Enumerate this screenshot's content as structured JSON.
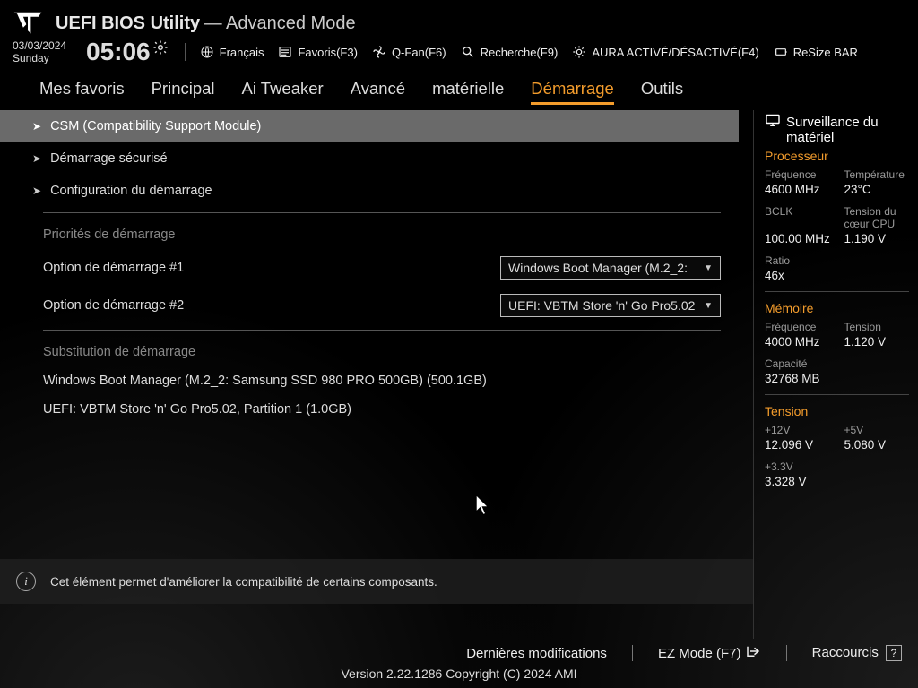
{
  "header": {
    "title": "UEFI BIOS Utility",
    "mode": "— Advanced Mode",
    "date": "03/03/2024",
    "day": "Sunday",
    "time": "05:06"
  },
  "shortcuts": {
    "language": "Français",
    "favorites": "Favoris(F3)",
    "qfan": "Q-Fan(F6)",
    "search": "Recherche(F9)",
    "aura": "AURA ACTIVÉ/DÉSACTIVÉ(F4)",
    "resize_bar": "ReSize BAR"
  },
  "tabs": {
    "favorites": "Mes favoris",
    "main": "Principal",
    "ai_tweaker": "Ai Tweaker",
    "advanced": "Avancé",
    "hardware": "matérielle",
    "boot": "Démarrage",
    "tools": "Outils"
  },
  "content": {
    "csm": "CSM (Compatibility Support Module)",
    "secure_boot": "Démarrage sécurisé",
    "boot_config": "Configuration du démarrage",
    "boot_priority": "Priorités de démarrage",
    "boot_option_1_label": "Option de démarrage #1",
    "boot_option_1_value": "Windows Boot Manager (M.2_2:",
    "boot_option_2_label": "Option de démarrage #2",
    "boot_option_2_value": "UEFI: VBTM Store 'n' Go Pro5.02",
    "boot_override": "Substitution de démarrage",
    "override_1": "Windows Boot Manager (M.2_2: Samsung SSD 980 PRO 500GB) (500.1GB)",
    "override_2": "UEFI: VBTM Store 'n' Go Pro5.02, Partition 1 (1.0GB)",
    "help_text": "Cet élément permet d'améliorer la compatibilité de certains composants."
  },
  "sidebar": {
    "title_line1": "Surveillance du",
    "title_line2": "matériel",
    "proc_heading": "Processeur",
    "freq_label": "Fréquence",
    "freq_value": "4600 MHz",
    "temp_label": "Température",
    "temp_value": "23°C",
    "bclk_label": "BCLK",
    "bclk_value": "100.00 MHz",
    "vcore_label": "Tension du cœur CPU",
    "vcore_value": "1.190 V",
    "ratio_label": "Ratio",
    "ratio_value": "46x",
    "mem_heading": "Mémoire",
    "mem_freq_label": "Fréquence",
    "mem_freq_value": "4000 MHz",
    "mem_tension_label": "Tension",
    "mem_tension_value": "1.120 V",
    "mem_cap_label": "Capacité",
    "mem_cap_value": "32768 MB",
    "volt_heading": "Tension",
    "v12_label": "+12V",
    "v12_value": "12.096 V",
    "v5_label": "+5V",
    "v5_value": "5.080 V",
    "v33_label": "+3.3V",
    "v33_value": "3.328 V"
  },
  "footer": {
    "last_mod": "Dernières modifications",
    "ez_mode": "EZ Mode (F7)",
    "shortcuts": "Raccourcis",
    "version": "Version 2.22.1286 Copyright (C) 2024 AMI"
  }
}
